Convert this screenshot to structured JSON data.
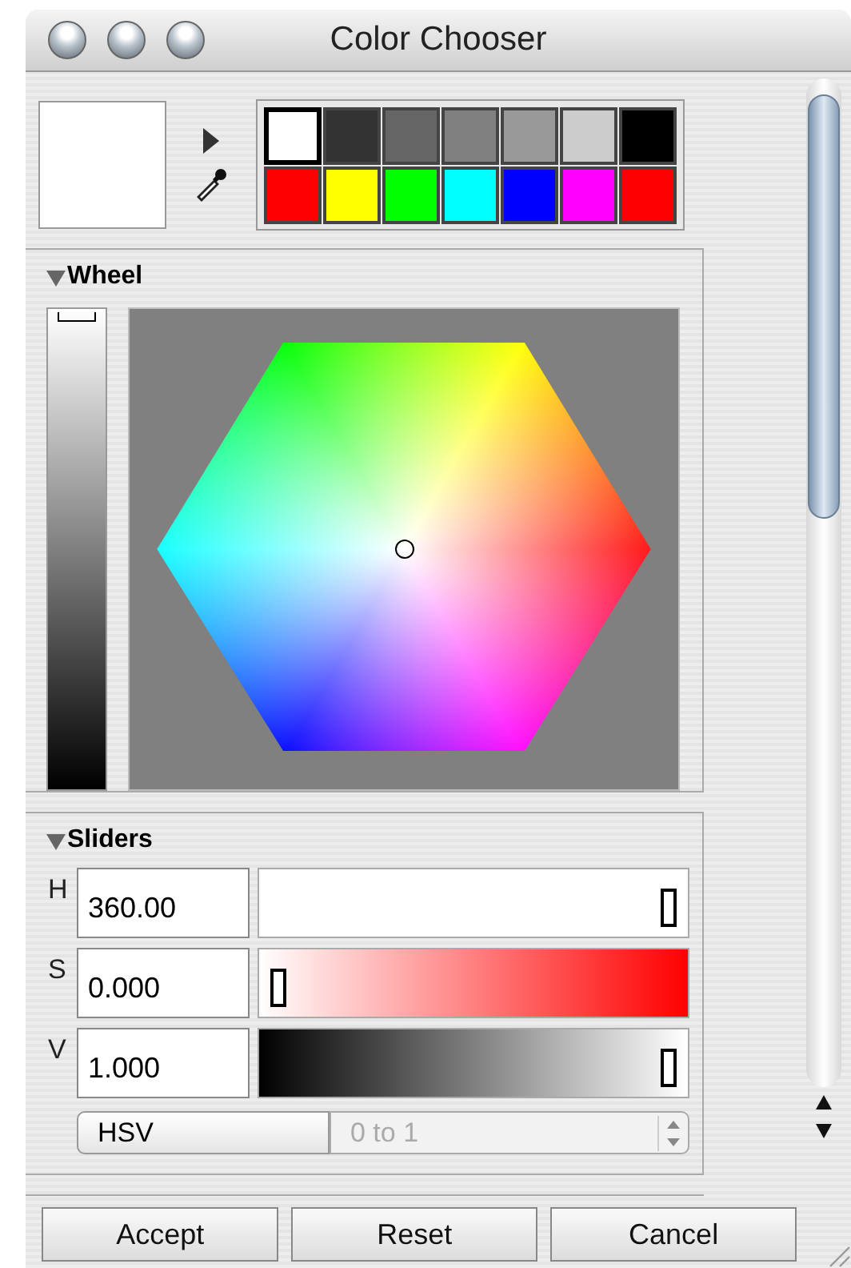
{
  "window": {
    "title": "Color Chooser"
  },
  "preview": {
    "color": "#ffffff"
  },
  "swatches": [
    {
      "color": "#ffffff",
      "selected": true
    },
    {
      "color": "#333333",
      "selected": false
    },
    {
      "color": "#666666",
      "selected": false
    },
    {
      "color": "#808080",
      "selected": false
    },
    {
      "color": "#999999",
      "selected": false
    },
    {
      "color": "#cccccc",
      "selected": false
    },
    {
      "color": "#000000",
      "selected": false
    },
    {
      "color": "#ff0000",
      "selected": false
    },
    {
      "color": "#ffff00",
      "selected": false
    },
    {
      "color": "#00ff00",
      "selected": false
    },
    {
      "color": "#00ffff",
      "selected": false
    },
    {
      "color": "#0000ff",
      "selected": false
    },
    {
      "color": "#ff00ff",
      "selected": false
    },
    {
      "color": "#ff0000",
      "selected": false
    }
  ],
  "wheel_section": {
    "title": "Wheel",
    "expanded": true,
    "brightness": {
      "level": 1
    }
  },
  "sliders_section": {
    "title": "Sliders",
    "expanded": true,
    "sliders": [
      {
        "kind": "hue",
        "label": "H",
        "value": "360.00",
        "level": 1
      },
      {
        "kind": "saturation",
        "label": "S",
        "value": "0.000",
        "level": 0
      },
      {
        "kind": "value",
        "label": "V",
        "value": "1.000",
        "level": 1
      }
    ],
    "mode": "HSV",
    "range": {
      "value": "0 to 1",
      "disabled": true
    }
  },
  "buttons": [
    "Accept",
    "Reset",
    "Cancel"
  ]
}
